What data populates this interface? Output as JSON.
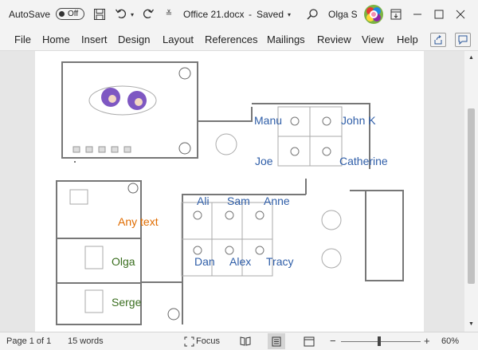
{
  "titlebar": {
    "autosave_label": "AutoSave",
    "autosave_state": "Off",
    "filename": "Office 21.docx",
    "dash": "-",
    "save_status": "Saved",
    "user_name": "Olga S"
  },
  "menu": [
    "File",
    "Home",
    "Insert",
    "Design",
    "Layout",
    "References",
    "Mailings",
    "Review",
    "View",
    "Help"
  ],
  "plan_labels": {
    "manu": "Manu",
    "john_k": "John K",
    "joe": "Joe",
    "catherine": "Catherine",
    "ali": "Ali",
    "sam": "Sam",
    "anne": "Anne",
    "dan": "Dan",
    "alex": "Alex",
    "tracy": "Tracy",
    "any_text": "Any text",
    "olga": "Olga",
    "serge": "Serge"
  },
  "colors": {
    "blue_label": "#2f5ea8",
    "orange_label": "#e06c00",
    "green_label": "#3a6e1f",
    "wall": "#777777"
  },
  "status": {
    "page": "Page 1 of 1",
    "words": "15 words",
    "focus": "Focus",
    "zoom_minus": "−",
    "zoom_plus": "+",
    "zoom": "60%",
    "zoom_level": 60
  }
}
